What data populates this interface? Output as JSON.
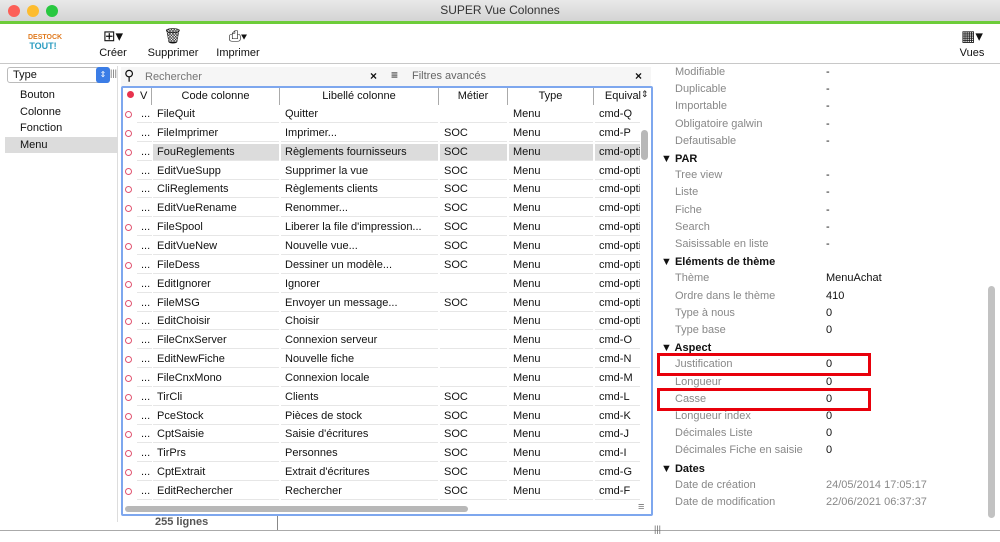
{
  "window": {
    "title": "SUPER Vue Colonnes"
  },
  "toolbar": {
    "logo_text": "DESTOCK TOUT",
    "create": "Créer",
    "delete": "Supprimer",
    "print": "Imprimer",
    "views": "Vues"
  },
  "left": {
    "select_value": "Type",
    "items": [
      "Bouton",
      "Colonne",
      "Fonction",
      "Menu"
    ],
    "selected": "Menu"
  },
  "search": {
    "placeholder": "Rechercher",
    "filters": "Filtres avancés"
  },
  "table": {
    "headers": [
      "V",
      "Code colonne",
      "Libellé colonne",
      "Métier",
      "Type",
      "Equival"
    ],
    "rows": [
      [
        "FileQuit",
        "Quitter",
        "",
        "Menu",
        "cmd-Q"
      ],
      [
        "FileImprimer",
        "Imprimer...",
        "SOC",
        "Menu",
        "cmd-P"
      ],
      [
        "FouReglements",
        "Règlements fournisseurs",
        "SOC",
        "Menu",
        "cmd-opti"
      ],
      [
        "EditVueSupp",
        "Supprimer la vue",
        "SOC",
        "Menu",
        "cmd-opti"
      ],
      [
        "CliReglements",
        "Règlements clients",
        "SOC",
        "Menu",
        "cmd-opti"
      ],
      [
        "EditVueRename",
        "Renommer...",
        "SOC",
        "Menu",
        "cmd-opti"
      ],
      [
        "FileSpool",
        "Liberer la file d'impression...",
        "SOC",
        "Menu",
        "cmd-opti"
      ],
      [
        "EditVueNew",
        "Nouvelle vue...",
        "SOC",
        "Menu",
        "cmd-opti"
      ],
      [
        "FileDess",
        "Dessiner un modèle...",
        "SOC",
        "Menu",
        "cmd-opti"
      ],
      [
        "EditIgnorer",
        "Ignorer",
        "",
        "Menu",
        "cmd-opti"
      ],
      [
        "FileMSG",
        "Envoyer un message...",
        "SOC",
        "Menu",
        "cmd-opti"
      ],
      [
        "EditChoisir",
        "Choisir",
        "",
        "Menu",
        "cmd-opti"
      ],
      [
        "FileCnxServer",
        "Connexion serveur",
        "",
        "Menu",
        "cmd-O"
      ],
      [
        "EditNewFiche",
        "Nouvelle fiche",
        "",
        "Menu",
        "cmd-N"
      ],
      [
        "FileCnxMono",
        "Connexion locale",
        "",
        "Menu",
        "cmd-M"
      ],
      [
        "TirCli",
        "Clients",
        "SOC",
        "Menu",
        "cmd-L"
      ],
      [
        "PceStock",
        "Pièces de stock",
        "SOC",
        "Menu",
        "cmd-K"
      ],
      [
        "CptSaisie",
        "Saisie d'écritures",
        "SOC",
        "Menu",
        "cmd-J"
      ],
      [
        "TirPrs",
        "Personnes",
        "SOC",
        "Menu",
        "cmd-I"
      ],
      [
        "CptExtrait",
        "Extrait d'écritures",
        "SOC",
        "Menu",
        "cmd-G"
      ],
      [
        "EditRechercher",
        "Rechercher",
        "SOC",
        "Menu",
        "cmd-F"
      ]
    ],
    "selected_row": 2,
    "footer": "255 lignes"
  },
  "properties": {
    "items": [
      {
        "k": "Modifiable",
        "v": "-"
      },
      {
        "k": "Duplicable",
        "v": "-"
      },
      {
        "k": "Importable",
        "v": "-"
      },
      {
        "k": "Obligatoire galwin",
        "v": "-"
      },
      {
        "k": "Defautisable",
        "v": "-"
      },
      {
        "h": "PAR"
      },
      {
        "k": "Tree view",
        "v": "-"
      },
      {
        "k": "Liste",
        "v": "-"
      },
      {
        "k": "Fiche",
        "v": "-"
      },
      {
        "k": "Search",
        "v": "-"
      },
      {
        "k": "Saisissable en liste",
        "v": "-"
      },
      {
        "h": "Eléments de thème"
      },
      {
        "k": "Thème",
        "v": "MenuAchat"
      },
      {
        "k": "Ordre dans le thème",
        "v": "410"
      },
      {
        "k": "Type à nous",
        "v": "0"
      },
      {
        "k": "Type base",
        "v": "0"
      },
      {
        "h": "Aspect"
      },
      {
        "k": "Justification",
        "v": "0",
        "hl": true
      },
      {
        "k": "Longueur",
        "v": "0"
      },
      {
        "k": "Casse",
        "v": "0",
        "hl": true
      },
      {
        "k": "Longueur index",
        "v": "0"
      },
      {
        "k": "Décimales Liste",
        "v": "0"
      },
      {
        "k": "Décimales Fiche en saisie",
        "v": "0"
      },
      {
        "h": "Dates"
      },
      {
        "k": "Date de création",
        "v": "24/05/2014 17:05:17",
        "grey": true
      },
      {
        "k": "Date de modification",
        "v": "22/06/2021 06:37:37",
        "grey": true
      }
    ]
  },
  "colors": {
    "accent": "#3b7de6",
    "highlight": "#e8000b",
    "titlebar_stripe": "#6dcc3a"
  }
}
